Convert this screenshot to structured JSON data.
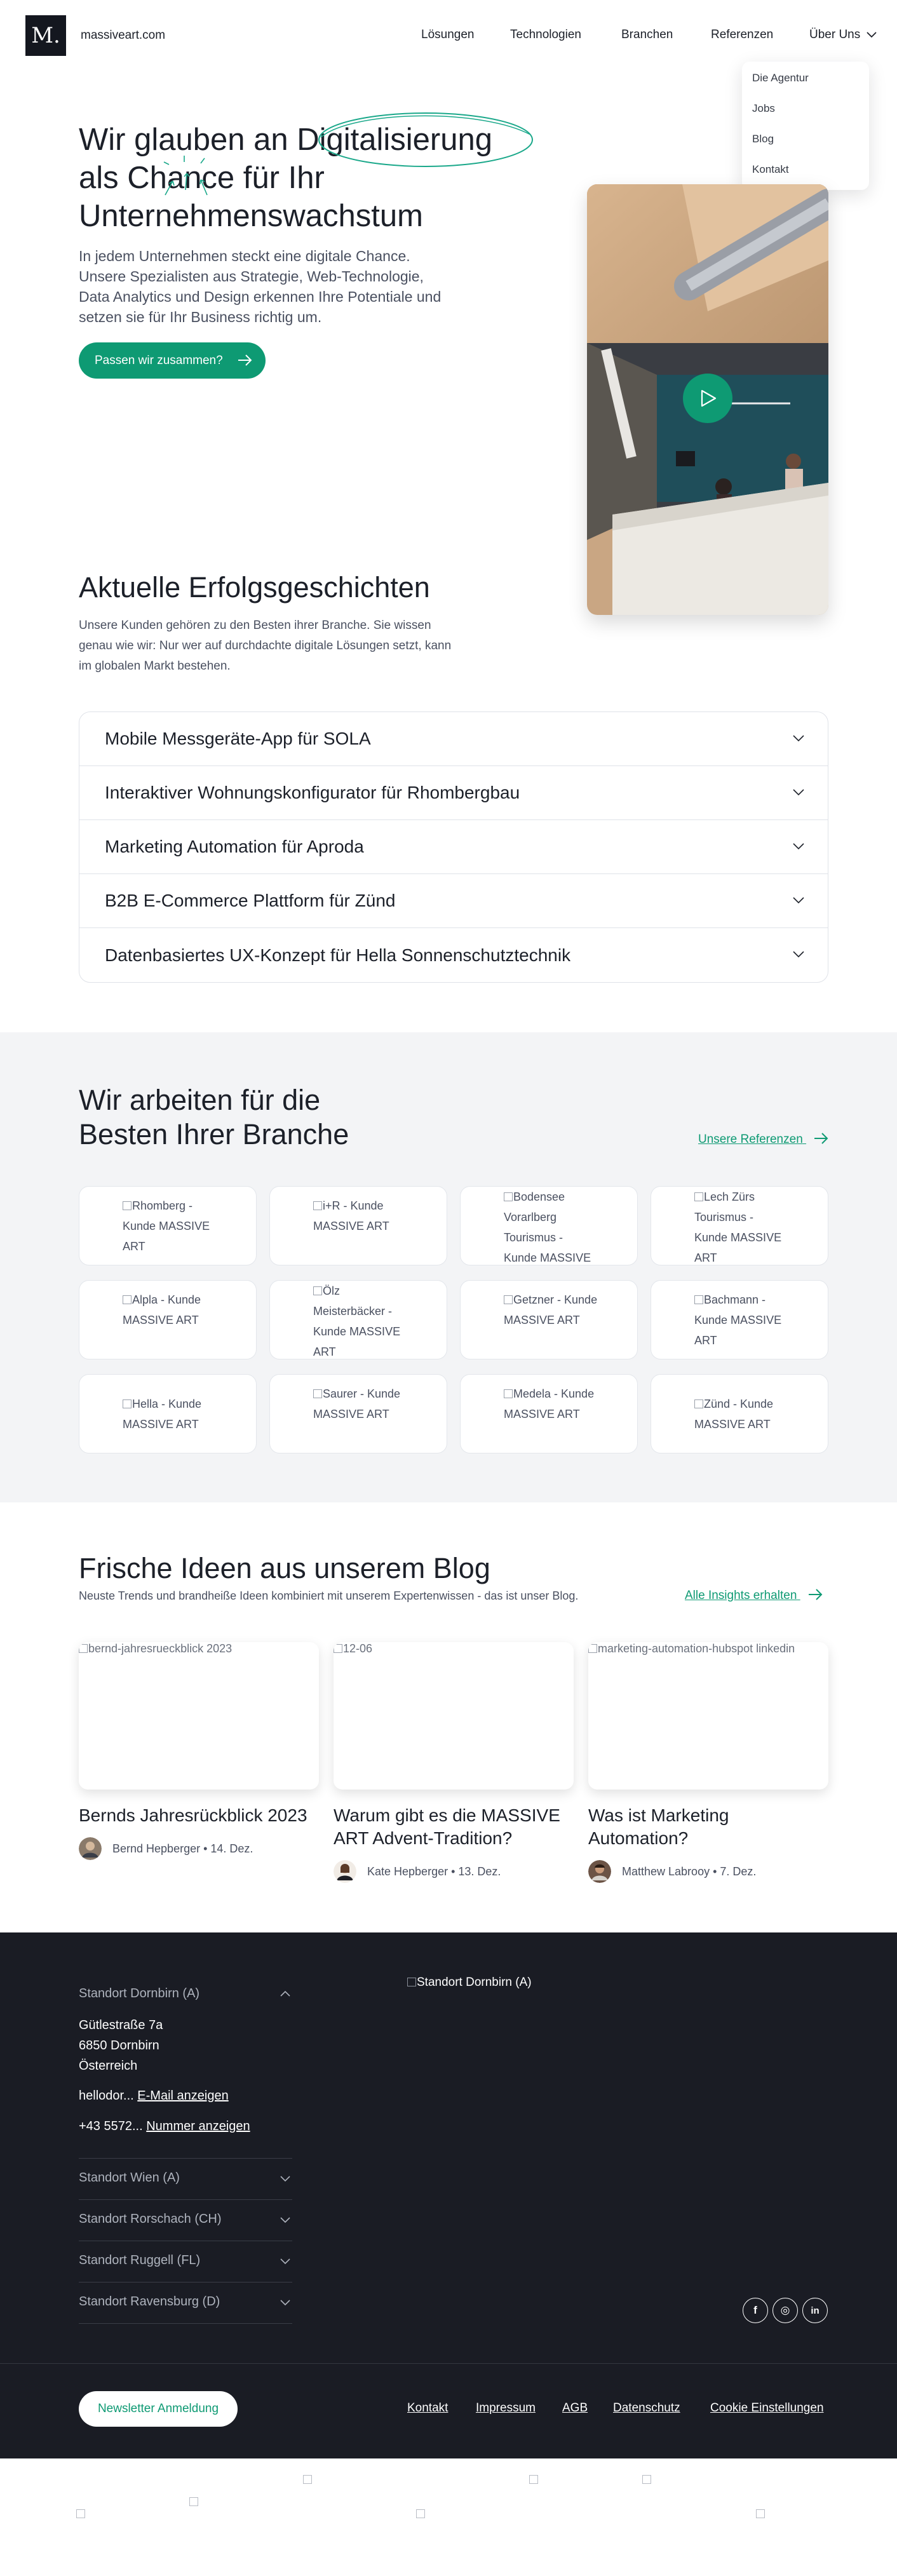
{
  "header": {
    "logo_mark": "M.",
    "site_name": "massiveart.com",
    "nav": [
      "Lösungen",
      "Technologien",
      "Branchen",
      "Referenzen",
      "Über Uns"
    ],
    "dropdown": [
      "Die Agentur",
      "Jobs",
      "Blog",
      "Kontakt"
    ]
  },
  "hero": {
    "title_pre": "Wir glauben an ",
    "title_highlight": "Digitalisierung",
    "title_line2_pre": "als ",
    "title_chance": "Chance",
    "title_line2_post": " für Ihr",
    "title_line3": "Unternehmenswachstum",
    "description": "In jedem Unternehmen steckt eine digitale Chance. Unsere Spezialisten aus Strategie, Web-Technologie, Data Analytics und Design erkennen Ihre Potentiale und setzen sie für Ihr Business richtig um.",
    "cta": "Passen wir zusammen?"
  },
  "success": {
    "title": "Aktuelle Erfolgsgeschichten",
    "description": "Unsere Kunden gehören zu den Besten ihrer Branche. Sie wissen genau wie wir: Nur wer auf durchdachte digitale Lösungen setzt, kann im globalen Markt bestehen.",
    "items": [
      "Mobile Messgeräte-App für SOLA",
      "Interaktiver Wohnungskonfigurator für Rhombergbau",
      "Marketing Automation für Aproda",
      "B2B E-Commerce Plattform für Zünd",
      "Datenbasiertes UX-Konzept für Hella Sonnenschutztechnik"
    ]
  },
  "clients": {
    "title_line1": "Wir arbeiten für die",
    "title_line2": "Besten Ihrer Branche",
    "link": "Unsere Referenzen",
    "cards": [
      "Rhomberg - Kunde MASSIVE ART",
      "i+R - Kunde MASSIVE ART",
      "Bodensee Vorarlberg Tourismus - Kunde MASSIVE",
      "Lech Zürs Tourismus - Kunde MASSIVE ART",
      "Alpla - Kunde MASSIVE ART",
      "Ölz Meisterbäcker - Kunde MASSIVE ART",
      "Getzner - Kunde MASSIVE ART",
      "Bachmann - Kunde MASSIVE ART",
      "Hella - Kunde MASSIVE ART",
      "Saurer - Kunde MASSIVE ART",
      "Medela - Kunde MASSIVE ART",
      "Zünd - Kunde MASSIVE ART"
    ]
  },
  "blog": {
    "title": "Frische Ideen aus unserem Blog",
    "subtitle": "Neuste Trends und brandheiße Ideen kombiniert mit unserem Expertenwissen - das ist unser Blog.",
    "link": "Alle Insights erhalten",
    "posts": [
      {
        "img_alt": "bernd-jahresrueckblick 2023",
        "title": "Bernds Jahresrückblick 2023",
        "meta": "Bernd Hepberger • 14. Dez."
      },
      {
        "img_alt": "12-06",
        "title": "Warum gibt es die MASSIVE ART Advent-Tradition?",
        "meta": "Kate Hepberger • 13. Dez."
      },
      {
        "img_alt": "marketing-automation-hubspot linkedin",
        "title": "Was ist Marketing Automation?",
        "meta": "Matthew Labrooy • 7. Dez."
      }
    ]
  },
  "footer": {
    "open_location": "Standort Dornbirn (A)",
    "address": [
      "Gütlestraße 7a",
      "6850 Dornbirn",
      "Österreich"
    ],
    "email_prefix": "hellodor...",
    "email_link": "E-Mail anzeigen",
    "phone_prefix": "+43 5572...",
    "phone_link": "Nummer anzeigen",
    "locations": [
      "Standort Wien (A)",
      "Standort Rorschach (CH)",
      "Standort Ruggell (FL)",
      "Standort Ravensburg (D)"
    ],
    "map_alt": "Standort Dornbirn (A)",
    "social": [
      "f",
      "◎",
      "in"
    ],
    "newsletter": "Newsletter Anmeldung",
    "links": [
      "Kontakt",
      "Impressum",
      "AGB",
      "Datenschutz",
      "Cookie Einstellungen"
    ]
  }
}
